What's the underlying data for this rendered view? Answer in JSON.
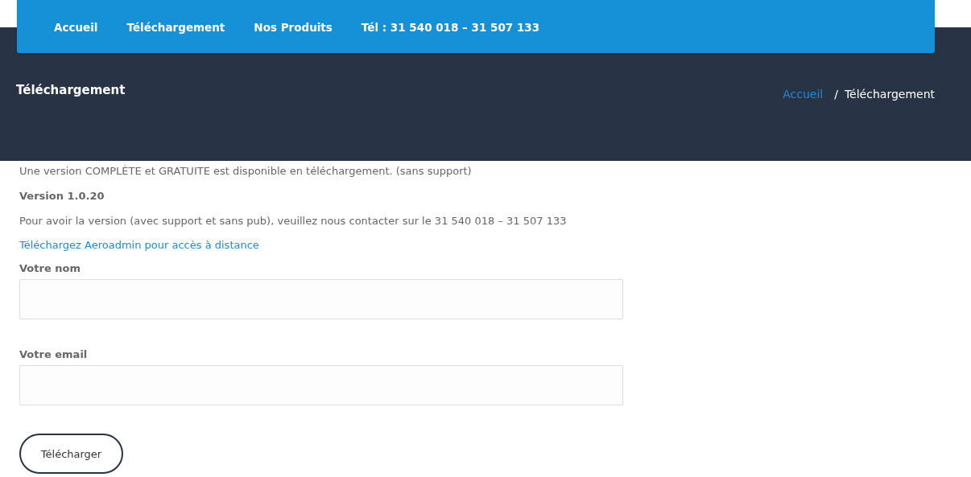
{
  "nav": {
    "items": [
      {
        "label": "Accueil"
      },
      {
        "label": "Téléchargement"
      },
      {
        "label": "Nos Produits"
      },
      {
        "label": "Tél : 31 540 018 – 31 507 133"
      }
    ]
  },
  "banner": {
    "title": "Téléchargement",
    "breadcrumb": {
      "link": "Accueil",
      "separator": "/",
      "current": "Téléchargement"
    }
  },
  "content": {
    "intro": "Une version COMPLÈTE et GRATUITE est disponible en téléchargement. (sans support)",
    "version": "Version 1.0.20",
    "contact": "Pour avoir la version (avec support et sans pub), veuillez nous contacter sur le 31 540 018 – 31 507 133",
    "link": "Téléchargez Aeroadmin pour accès à distance"
  },
  "form": {
    "fields": [
      {
        "label": "Votre nom"
      },
      {
        "label": "Votre email"
      }
    ],
    "submit": "Télécharger"
  }
}
